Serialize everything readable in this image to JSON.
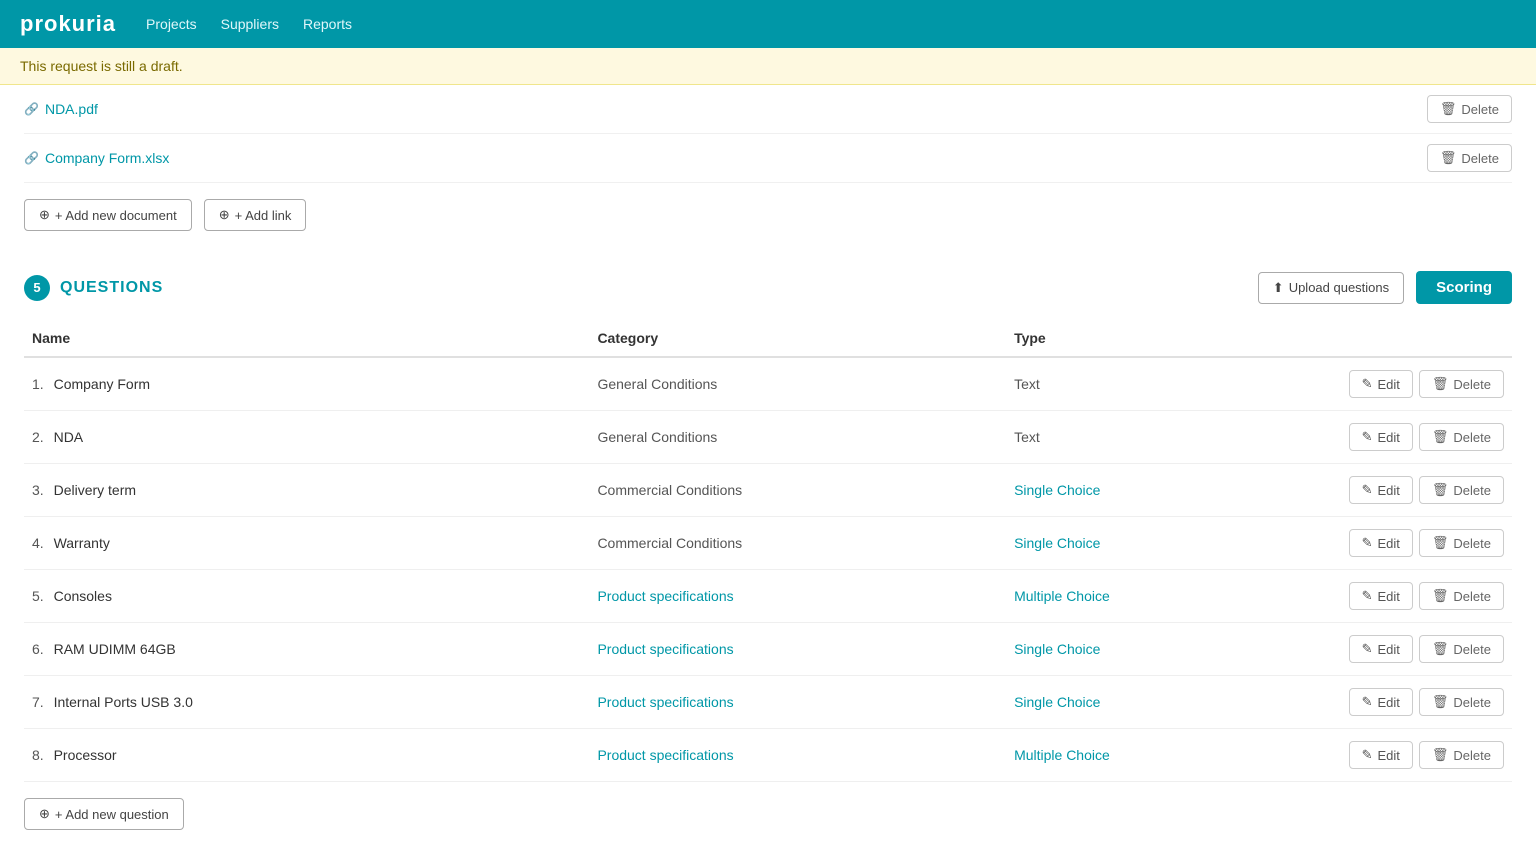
{
  "navbar": {
    "logo": "prokuria",
    "nav_items": [
      "Projects",
      "Suppliers",
      "Reports"
    ]
  },
  "draft_banner": {
    "text": "This request is still a draft."
  },
  "files": [
    {
      "name": "NDA.pdf",
      "id": "nda-pdf"
    },
    {
      "name": "Company Form.xlsx",
      "id": "company-form-xlsx"
    }
  ],
  "doc_actions": {
    "add_document_label": "+ Add new document",
    "add_link_label": "+ Add link"
  },
  "questions": {
    "count": 5,
    "title": "QUESTIONS",
    "upload_button": "Upload questions",
    "scoring_button": "Scoring",
    "add_question_button": "+ Add new question",
    "columns": {
      "name": "Name",
      "category": "Category",
      "type": "Type"
    },
    "rows": [
      {
        "num": "1.",
        "name": "Company Form",
        "category": "General Conditions",
        "category_class": "cat-general",
        "type": "Text",
        "type_class": "type-text"
      },
      {
        "num": "2.",
        "name": "NDA",
        "category": "General Conditions",
        "category_class": "cat-general",
        "type": "Text",
        "type_class": "type-text"
      },
      {
        "num": "3.",
        "name": "Delivery term",
        "category": "Commercial Conditions",
        "category_class": "cat-commercial",
        "type": "Single Choice",
        "type_class": "type-single"
      },
      {
        "num": "4.",
        "name": "Warranty",
        "category": "Commercial Conditions",
        "category_class": "cat-commercial",
        "type": "Single Choice",
        "type_class": "type-single"
      },
      {
        "num": "5.",
        "name": "Consoles",
        "category": "Product specifications",
        "category_class": "cat-product",
        "type": "Multiple Choice",
        "type_class": "type-multiple"
      },
      {
        "num": "6.",
        "name": "RAM UDIMM 64GB",
        "category": "Product specifications",
        "category_class": "cat-product",
        "type": "Single Choice",
        "type_class": "type-single"
      },
      {
        "num": "7.",
        "name": "Internal Ports USB 3.0",
        "category": "Product specifications",
        "category_class": "cat-product",
        "type": "Single Choice",
        "type_class": "type-single"
      },
      {
        "num": "8.",
        "name": "Processor",
        "category": "Product specifications",
        "category_class": "cat-product",
        "type": "Multiple Choice",
        "type_class": "type-multiple"
      }
    ],
    "edit_label": "Edit",
    "delete_label": "Delete"
  }
}
